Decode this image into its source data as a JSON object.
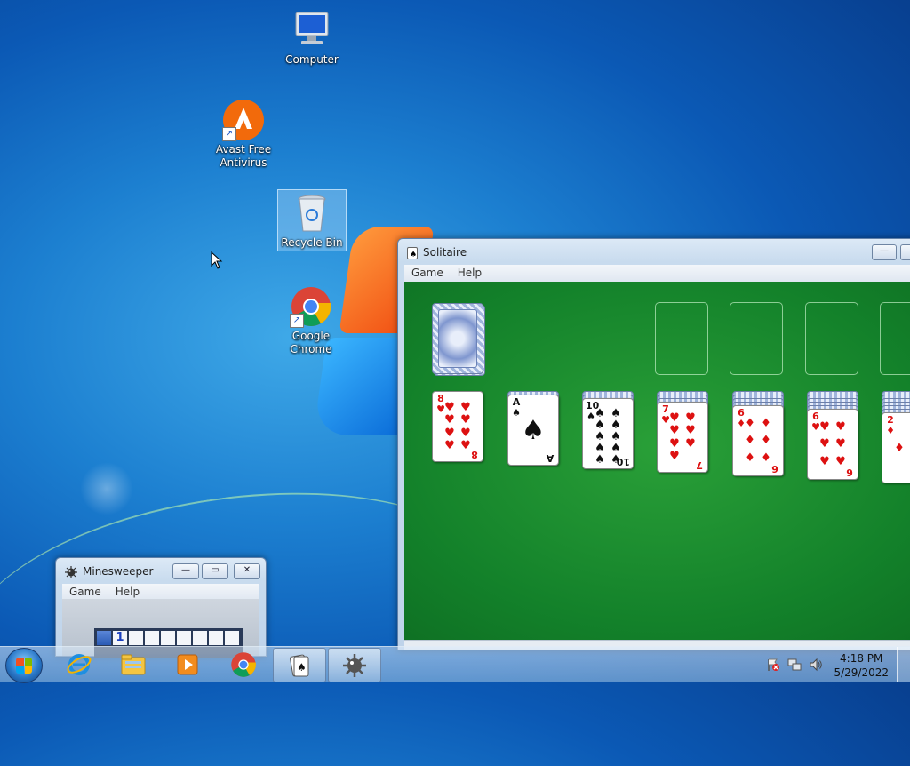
{
  "desktop": {
    "icons": [
      {
        "label": "Computer",
        "icon": "computer-icon"
      },
      {
        "label": "Avast Free Antivirus",
        "icon": "avast-icon"
      },
      {
        "label": "Recycle Bin",
        "icon": "recycle-bin-icon"
      },
      {
        "label": "Google Chrome",
        "icon": "chrome-icon"
      }
    ]
  },
  "solitaire": {
    "title": "Solitaire",
    "menu": [
      "Game",
      "Help"
    ],
    "buttons": {
      "minimize": "—"
    },
    "tableau": [
      {
        "rank": "8",
        "suit": "♥",
        "color": "red",
        "hidden": 0
      },
      {
        "rank": "A",
        "suit": "♠",
        "color": "black",
        "hidden": 1
      },
      {
        "rank": "10",
        "suit": "♠",
        "color": "black",
        "hidden": 2
      },
      {
        "rank": "7",
        "suit": "♥",
        "color": "red",
        "hidden": 3
      },
      {
        "rank": "6",
        "suit": "♦",
        "color": "red",
        "hidden": 4
      },
      {
        "rank": "6",
        "suit": "♥",
        "color": "red",
        "hidden": 5
      },
      {
        "rank": "2",
        "suit": "♦",
        "color": "red",
        "hidden": 6
      }
    ]
  },
  "minesweeper": {
    "title": "Minesweeper",
    "menu": [
      "Game",
      "Help"
    ],
    "buttons": {
      "minimize": "—",
      "maximize": "▭",
      "close": "✕"
    },
    "revealed_number": "1"
  },
  "taskbar": {
    "pinned": [
      "internet-explorer-icon",
      "windows-explorer-icon",
      "media-player-icon",
      "chrome-icon",
      "solitaire-icon",
      "minesweeper-icon"
    ],
    "tray_icons": [
      "action-center-flag-icon",
      "network-icon",
      "volume-icon"
    ],
    "clock": {
      "time": "4:18 PM",
      "date": "5/29/2022"
    }
  },
  "colors": {
    "felt": "#13812a",
    "desktop": "#1c7fd0",
    "accent": "#2a78c8"
  }
}
